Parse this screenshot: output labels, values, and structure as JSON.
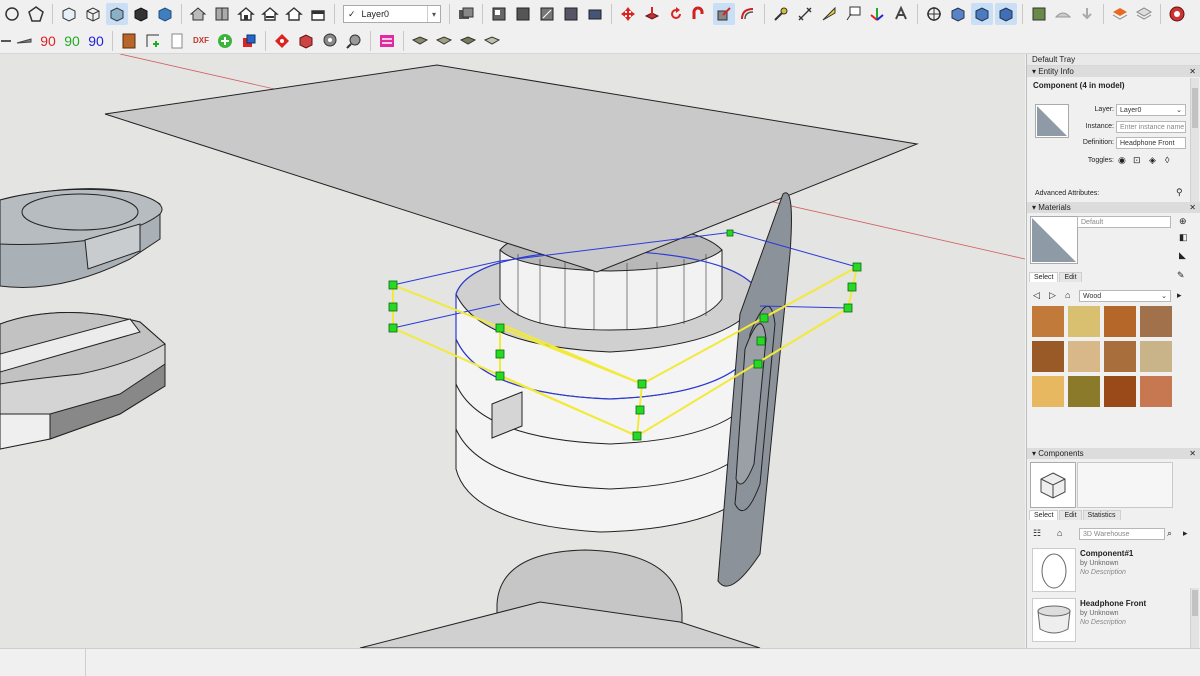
{
  "toolbar": {
    "layer_select_value": "Layer0",
    "layer_check": "✓",
    "rotate_values": [
      "90",
      "90",
      "90"
    ],
    "dxf_label": "DXF"
  },
  "tray": {
    "title": "Default Tray",
    "entity_info": {
      "header": "Entity Info",
      "component_title": "Component (4 in model)",
      "layer_label": "Layer:",
      "layer_value": "Layer0",
      "instance_label": "Instance:",
      "instance_placeholder": "Enter instance name",
      "definition_label": "Definition:",
      "definition_value": "Headphone Front",
      "toggles_label": "Toggles:",
      "advanced_label": "Advanced Attributes:"
    },
    "materials": {
      "header": "Materials",
      "material_name": "Default",
      "tabs": [
        "Select",
        "Edit"
      ],
      "library_value": "Wood",
      "swatch_colors": [
        "#c27a3a",
        "#d9c070",
        "#b5672a",
        "#a0714a",
        "#9a5a28",
        "#d8b888",
        "#a86e3c",
        "#c8b488",
        "#e8b860",
        "#8a7a2a",
        "#9a4a18",
        "#c87850"
      ]
    },
    "components": {
      "header": "Components",
      "tabs": [
        "Select",
        "Edit",
        "Statistics"
      ],
      "search_placeholder": "3D Warehouse",
      "items": [
        {
          "name": "Component#1",
          "by": "by Unknown",
          "desc": "No Description"
        },
        {
          "name": "Headphone Front",
          "by": "by Unknown",
          "desc": "No Description"
        }
      ]
    }
  },
  "colors": {
    "viewport_bg": "#e4e4e2",
    "selection_box": "#f2ea3a",
    "selection_edge": "#2b3bd8",
    "grip": "#27d827",
    "red_axis": "#d06060"
  }
}
